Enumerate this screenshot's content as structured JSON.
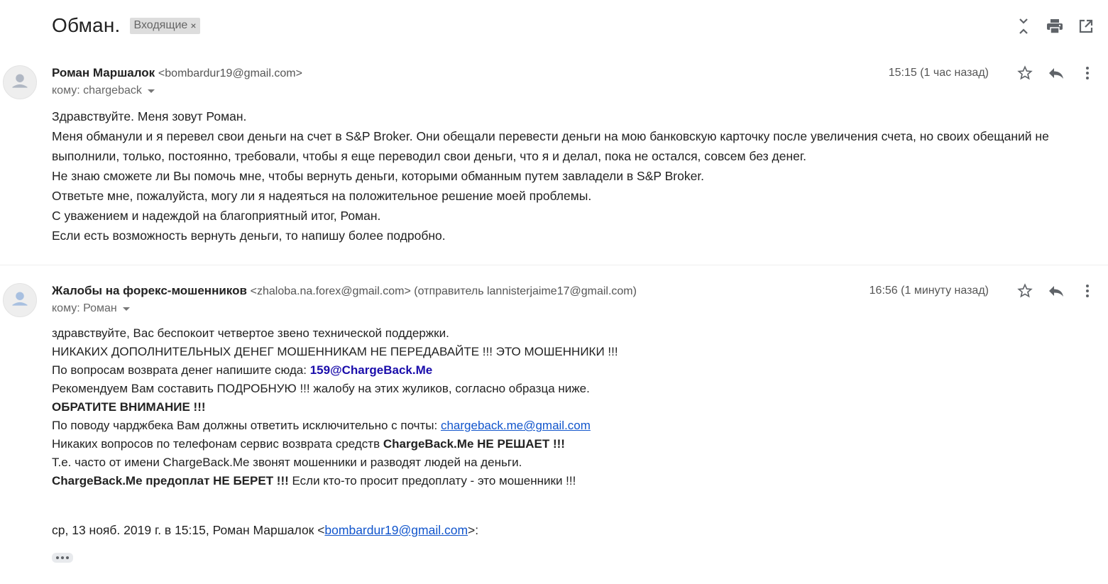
{
  "thread": {
    "subject": "Обман.",
    "label": "Входящие",
    "label_remove": "×",
    "top_actions": [
      "collapse-all-icon",
      "print-icon",
      "open-in-new-window-icon"
    ]
  },
  "messages": [
    {
      "sender_name": "Роман Маршалок",
      "sender_email": "<bombardur19@gmail.com>",
      "to": "кому: chargeback",
      "time": "15:15 (1 час назад)",
      "body": [
        "Здравствуйте. Меня зовут Роман.",
        "Меня обманули и я перевел свои деньги на счет в S&P Broker. Они обещали перевести деньги на мою банковскую карточку после увеличения счета, но своих обещаний не выполнили, только, постоянно, требовали, чтобы я еще переводил свои деньги, что я и делал, пока не остался, совсем без денег.",
        "Не знаю сможете ли Вы помочь мне, чтобы вернуть деньги, которыми обманным путем завладели в S&P Broker.",
        "Ответьте мне, пожалуйста, могу ли я надеяться на положительное решение моей проблемы.",
        "С уважением и надеждой на благоприятный итог, Роман.",
        "Если есть возможность вернуть деньги, то напишу более подробно."
      ]
    },
    {
      "sender_name": "Жалобы на форекс-мошенников",
      "sender_email": "<zhaloba.na.forex@gmail.com> (отправитель lannisterjaime17@gmail.com)",
      "to": "кому: Роман",
      "time": "16:56 (1 минуту назад)",
      "body": {
        "line1": "здравствуйте, Вас беспокоит четвертое звено технической поддержки.",
        "line2": "НИКАКИХ ДОПОЛНИТЕЛЬНЫХ ДЕНЕГ МОШЕННИКАМ НЕ ПЕРЕДАВАЙТЕ !!! ЭТО МОШЕННИКИ !!!",
        "line3_prefix": "По вопросам возврата денег напишите сюда: ",
        "line3_link": "159@ChargeBack.Me",
        "line4": "Рекомендуем Вам составить ПОДРОБНУЮ !!! жалобу на этих жуликов, согласно образца ниже.",
        "line5": "ОБРАТИТЕ ВНИМАНИЕ !!!",
        "line6_prefix": "По поводу чарджбека Вам должны ответить исключительно с почты: ",
        "line6_link": "chargeback.me@gmail.com",
        "line7_prefix": "Никаких вопросов по телефонам сервис возврата средств ",
        "line7_bold": "ChargeBack.Me НЕ РЕШАЕТ !!!",
        "line8": "Т.е. часто от имени ChargeBack.Me звонят мошенники и разводят людей на деньги.",
        "line9_bold": "ChargeBack.Me предоплат НЕ БЕРЕТ !!!",
        "line9_suffix": " Если кто-то просит предоплату - это мошенники !!!"
      },
      "quote": {
        "prefix": "ср, 13 нояб. 2019 г. в 15:15, Роман Маршалок <",
        "link": "bombardur19@gmail.com",
        "suffix": ">:"
      }
    }
  ],
  "colors": {
    "link": "#1155cc",
    "bold_link": "#1a0dab",
    "chip_bg": "#dddddd",
    "icon": "#5f6368"
  }
}
